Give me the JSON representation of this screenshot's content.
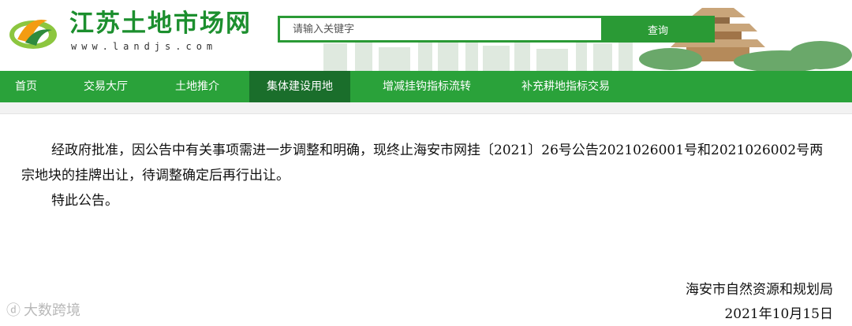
{
  "header": {
    "site_title": "江苏土地市场网",
    "site_domain": "www.landjs.com"
  },
  "search": {
    "placeholder": "请输入关键字",
    "button_label": "查询"
  },
  "nav": {
    "items": [
      {
        "label": "首页",
        "active": false
      },
      {
        "label": "交易大厅",
        "active": false
      },
      {
        "label": "土地推介",
        "active": false
      },
      {
        "label": "集体建设用地",
        "active": true
      },
      {
        "label": "增减挂钩指标流转",
        "active": false
      },
      {
        "label": "补充耕地指标交易",
        "active": false
      }
    ]
  },
  "notice": {
    "paragraph1": "经政府批准，因公告中有关事项需进一步调整和明确，现终止海安市网挂〔2021〕26号公告2021026001号和2021026002号两宗地块的挂牌出让，待调整确定后再行出让。",
    "paragraph2": "特此公告。",
    "signature_org": "海安市自然资源和规划局",
    "signature_date": "2021年10月15日"
  },
  "watermark": {
    "text": "大数跨境"
  },
  "colors": {
    "brand_green": "#2aa23a",
    "nav_active": "#1a6e2b",
    "title_green": "#1c8f2e"
  }
}
